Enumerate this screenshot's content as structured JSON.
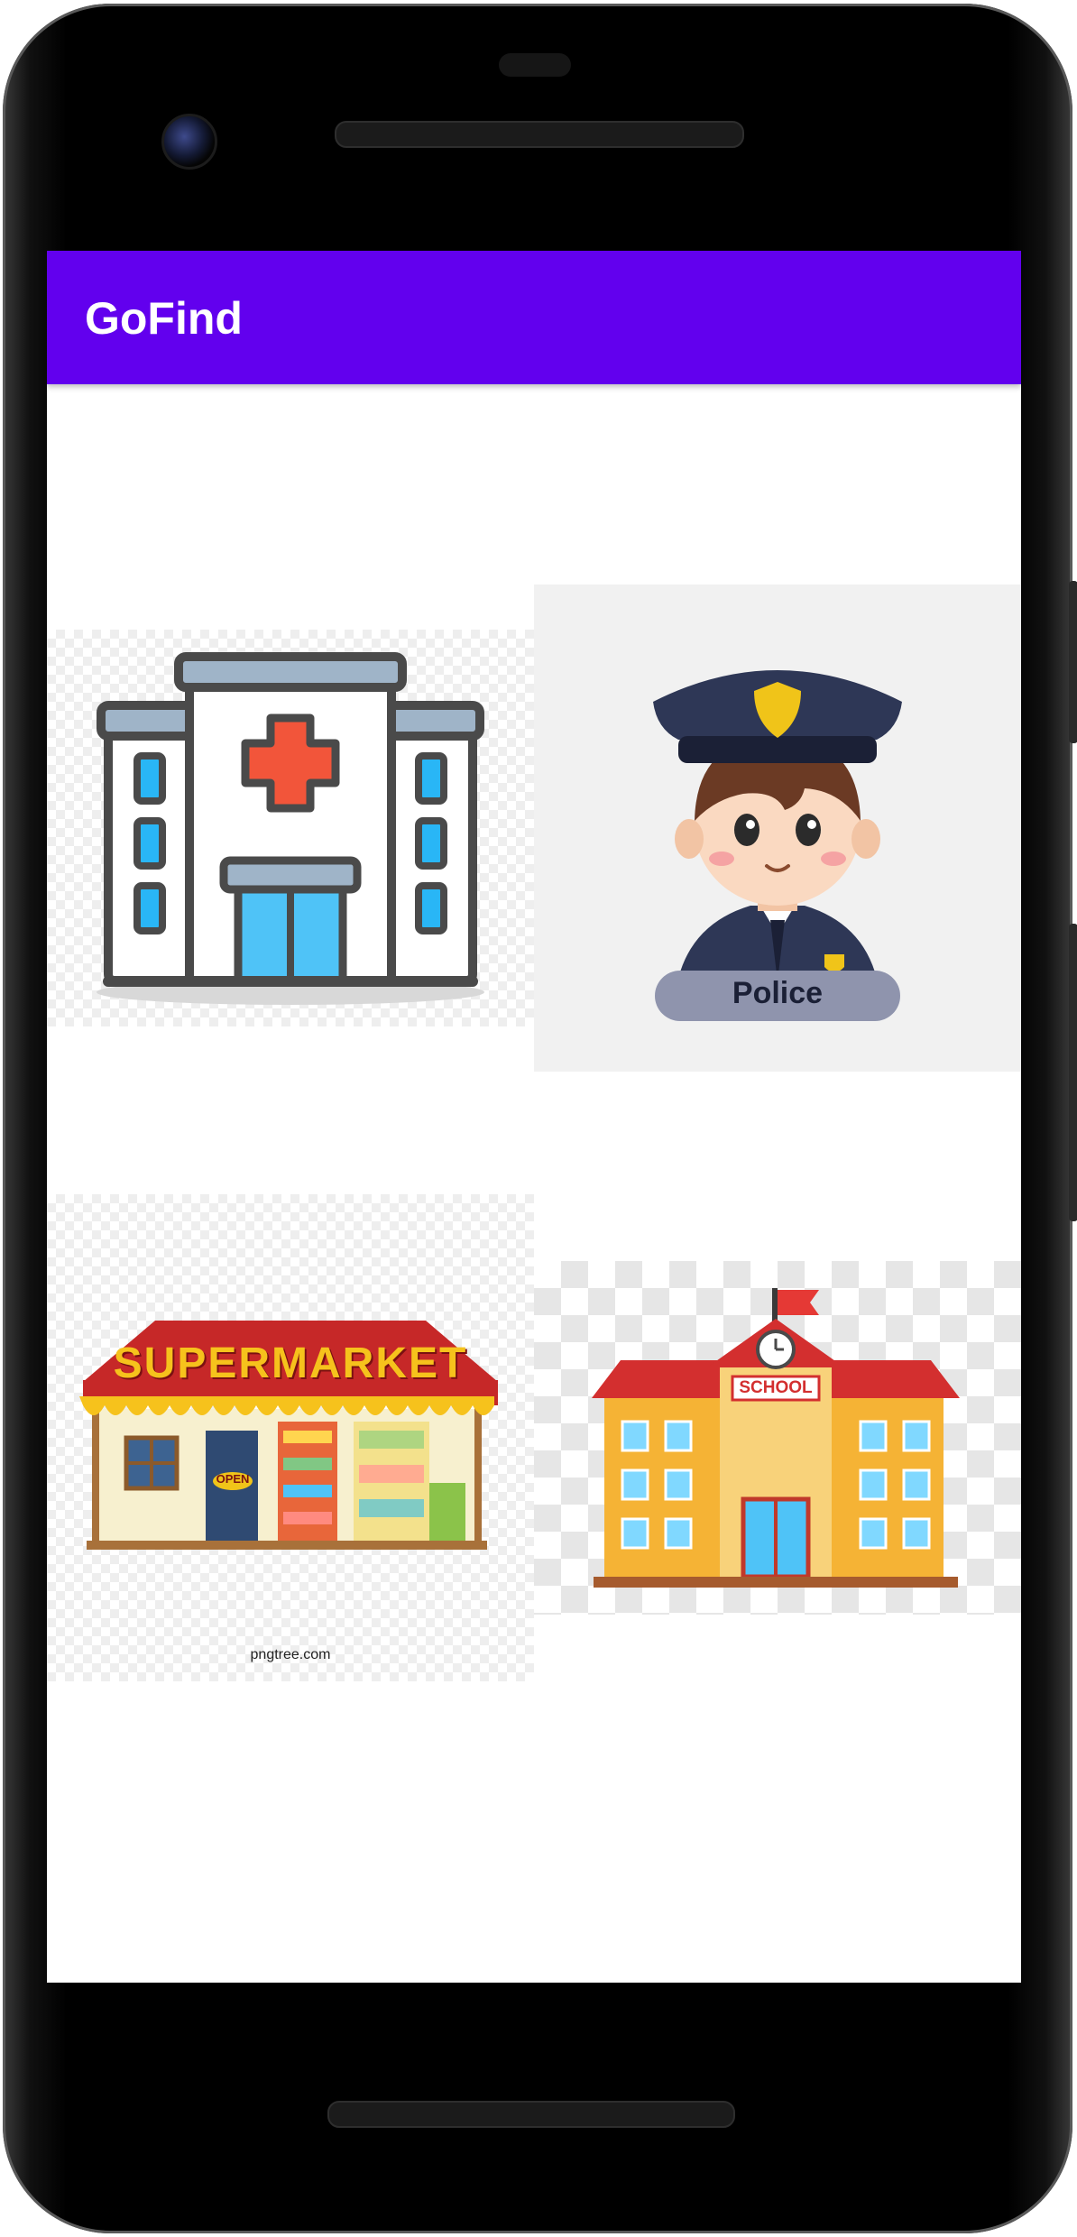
{
  "app": {
    "title": "GoFind"
  },
  "tiles": {
    "hospital": {
      "icon": "hospital-building-icon"
    },
    "police": {
      "icon": "police-officer-icon",
      "label": "Police"
    },
    "supermarket": {
      "icon": "supermarket-store-icon",
      "sign": "SUPERMARKET",
      "door_sign": "OPEN",
      "watermark": "pngtree.com"
    },
    "school": {
      "icon": "school-building-icon",
      "sign": "SCHOOL"
    }
  },
  "colors": {
    "appbar": "#6200EE",
    "appbar_text": "#FFFFFF",
    "screen_bg": "#FFFFFF"
  }
}
